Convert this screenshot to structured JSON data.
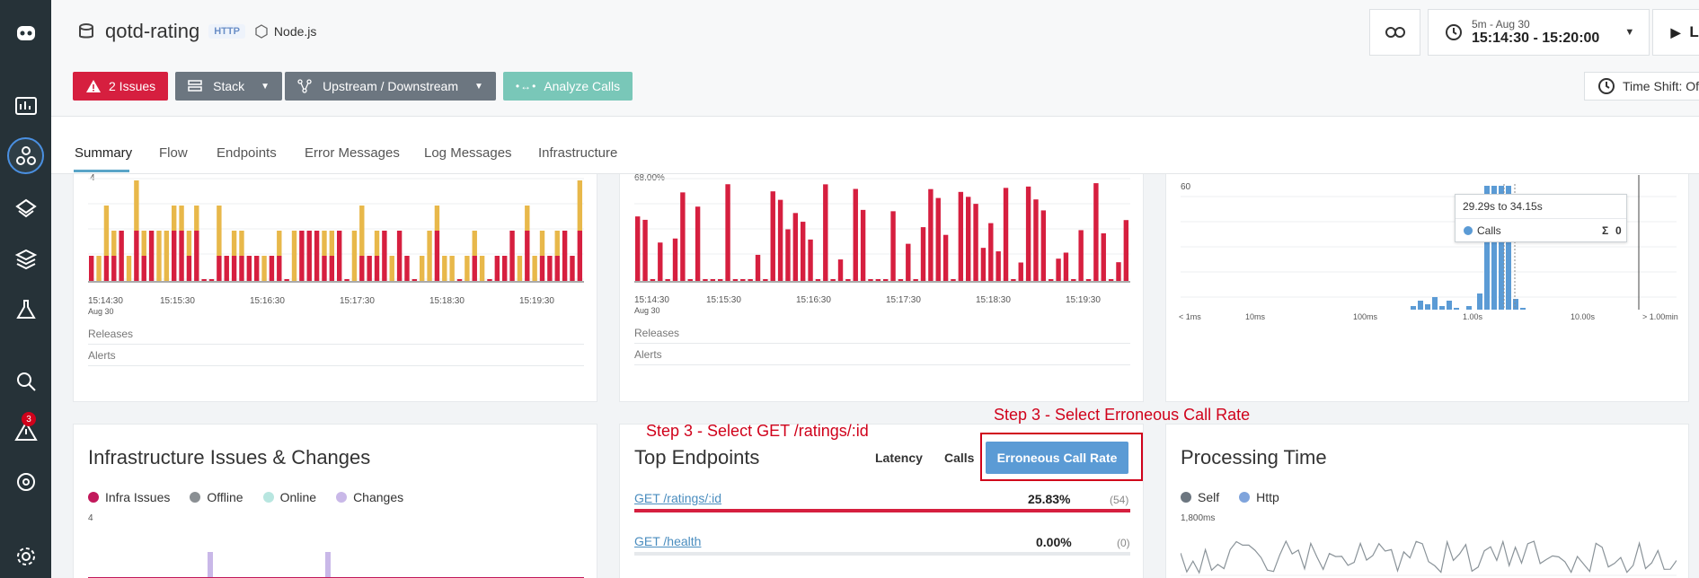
{
  "service": {
    "title": "qotd-rating",
    "protocol": "HTTP",
    "technology": "Node.js"
  },
  "toolbar": {
    "issues_label": "2 Issues",
    "stack_label": "Stack",
    "upstream_label": "Upstream / Downstream",
    "analyze_label": "Analyze Calls"
  },
  "time": {
    "window_label": "5m - Aug 30",
    "range": "15:14:30 - 15:20:00",
    "live_label": "Live",
    "timeshift_label": "Time Shift: Off"
  },
  "nav": {
    "issues_badge": "3"
  },
  "tabs": [
    "Summary",
    "Flow",
    "Endpoints",
    "Error Messages",
    "Log Messages",
    "Infrastructure"
  ],
  "charts": {
    "left_ymax": "4",
    "mid_ymax": "68.00%",
    "right_ymax": "60",
    "time_ticks": [
      "15:14:30",
      "15:15:30",
      "15:16:30",
      "15:17:30",
      "15:18:30",
      "15:19:30"
    ],
    "date_label": "Aug 30",
    "releases_label": "Releases",
    "alerts_label": "Alerts",
    "latency_ticks": [
      "< 1ms",
      "10ms",
      "100ms",
      "1.00s",
      "10.00s",
      "> 1.00min"
    ],
    "tooltip_range": "29.29s to 34.15s",
    "tooltip_series": "Calls",
    "tooltip_sigma": "Σ",
    "tooltip_value": "0"
  },
  "infra_card": {
    "title": "Infrastructure Issues & Changes",
    "legend": [
      "Infra Issues",
      "Offline",
      "Online",
      "Changes"
    ],
    "ymax": "4"
  },
  "endpoints_card": {
    "title": "Top Endpoints",
    "sort_latency": "Latency",
    "sort_calls": "Calls",
    "sort_error": "Erroneous Call Rate",
    "annotation_left": "Step 3 - Select GET /ratings/:id",
    "annotation_right": "Step 3 - Select Erroneous Call Rate",
    "rows": [
      {
        "name": "GET /ratings/:id",
        "value": "25.83%",
        "count": "(54)",
        "fill": 1.0
      },
      {
        "name": "GET /health",
        "value": "0.00%",
        "count": "(0)",
        "fill": 0.0
      }
    ]
  },
  "processing_card": {
    "title": "Processing Time",
    "legend": [
      "Self",
      "Http"
    ],
    "ymax": "1,800ms"
  },
  "colors": {
    "error_red": "#d61f3f",
    "warning_yellow": "#e8b84a",
    "accent_blue": "#5b9bd5",
    "nav_bg": "#263238"
  }
}
